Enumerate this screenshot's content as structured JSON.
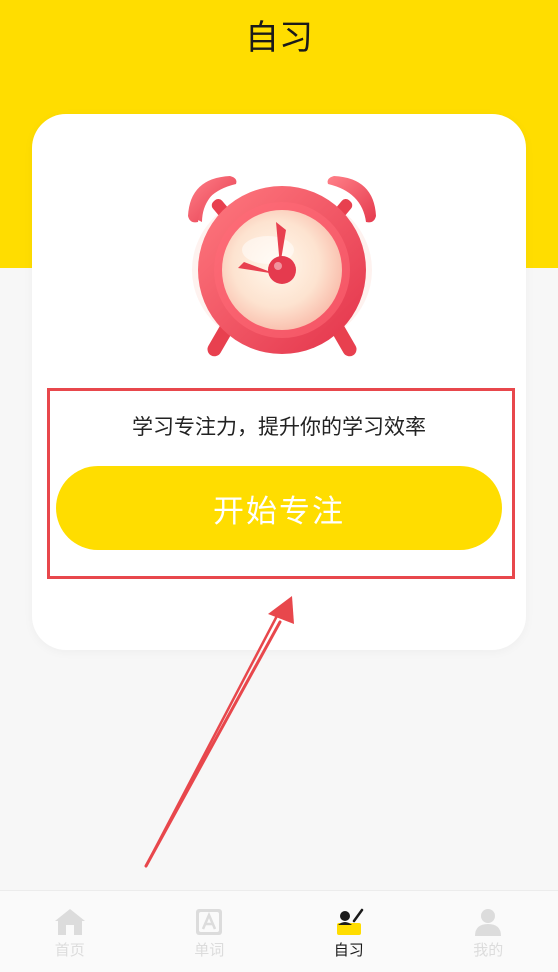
{
  "header": {
    "title": "自习"
  },
  "card": {
    "tagline": "学习专注力，提升你的学习效率",
    "start_label": "开始专注"
  },
  "tabs": [
    {
      "label": "首页",
      "icon": "home-icon",
      "active": false
    },
    {
      "label": "单词",
      "icon": "word-card-icon",
      "active": false
    },
    {
      "label": "自习",
      "icon": "study-desk-icon",
      "active": true
    },
    {
      "label": "我的",
      "icon": "user-icon",
      "active": false
    }
  ],
  "colors": {
    "brand_yellow": "#FFDD00",
    "annotation_red": "#E8474C",
    "inactive_tab": "#dcdcdc",
    "clock_red": "#F0485A"
  }
}
